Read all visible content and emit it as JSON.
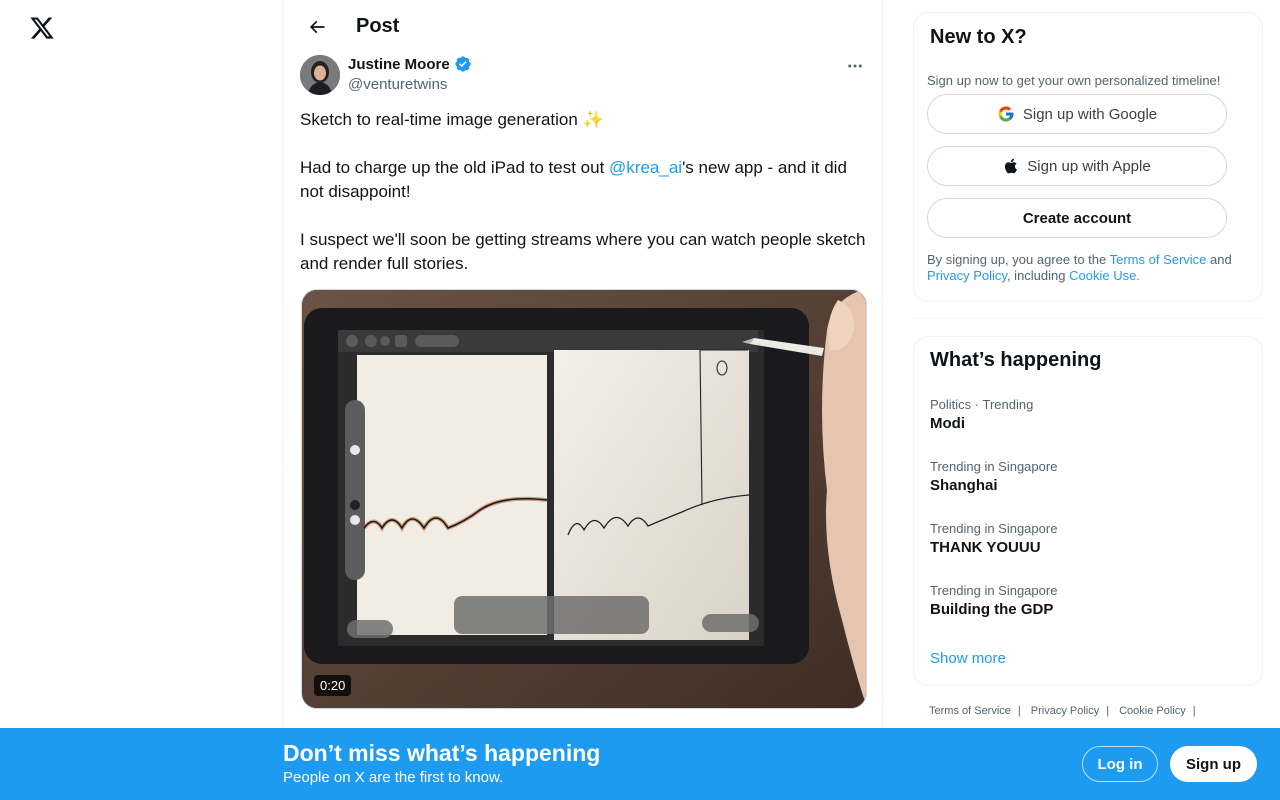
{
  "app": {
    "logo_icon": "x-logo-icon",
    "accent_color": "#1d9bf0"
  },
  "header": {
    "title": "Post",
    "back_icon": "arrow-left-icon"
  },
  "post": {
    "author_name": "Justine Moore",
    "author_handle": "@venturetwins",
    "verified": true,
    "more_icon": "more-horizontal-icon",
    "text_line1": "Sketch to real-time image generation ✨",
    "text_para2_before": "Had to charge up the old iPad to test out ",
    "text_para2_mention": "@krea_ai",
    "text_para2_after": "'s new app - and it did not disappoint!",
    "text_para3": "I suspect we'll soon be getting streams where you can watch people sketch and render full stories.",
    "media": {
      "type": "video",
      "duration": "0:20"
    }
  },
  "signup": {
    "title": "New to X?",
    "subtitle": "Sign up now to get your own personalized timeline!",
    "google_label": "Sign up with Google",
    "apple_label": "Sign up with Apple",
    "create_label": "Create account",
    "legal_prefix": "By signing up, you agree to the ",
    "legal_tos": "Terms of Service",
    "legal_and": " and ",
    "legal_privacy": "Privacy Policy",
    "legal_including": ", including ",
    "legal_cookie": "Cookie Use."
  },
  "trends": {
    "title": "What’s happening",
    "items": [
      {
        "meta": "Politics · Trending",
        "name": "Modi"
      },
      {
        "meta": "Trending in Singapore",
        "name": "Shanghai"
      },
      {
        "meta": "Trending in Singapore",
        "name": "THANK YOUUU"
      },
      {
        "meta": "Trending in Singapore",
        "name": "Building the GDP"
      }
    ],
    "show_more": "Show more"
  },
  "footer": {
    "links": [
      "Terms of Service",
      "Privacy Policy",
      "Cookie Policy"
    ],
    "separator": "|"
  },
  "bottom_bar": {
    "title": "Don’t miss what’s happening",
    "subtitle": "People on X are the first to know.",
    "login_label": "Log in",
    "signup_label": "Sign up"
  }
}
